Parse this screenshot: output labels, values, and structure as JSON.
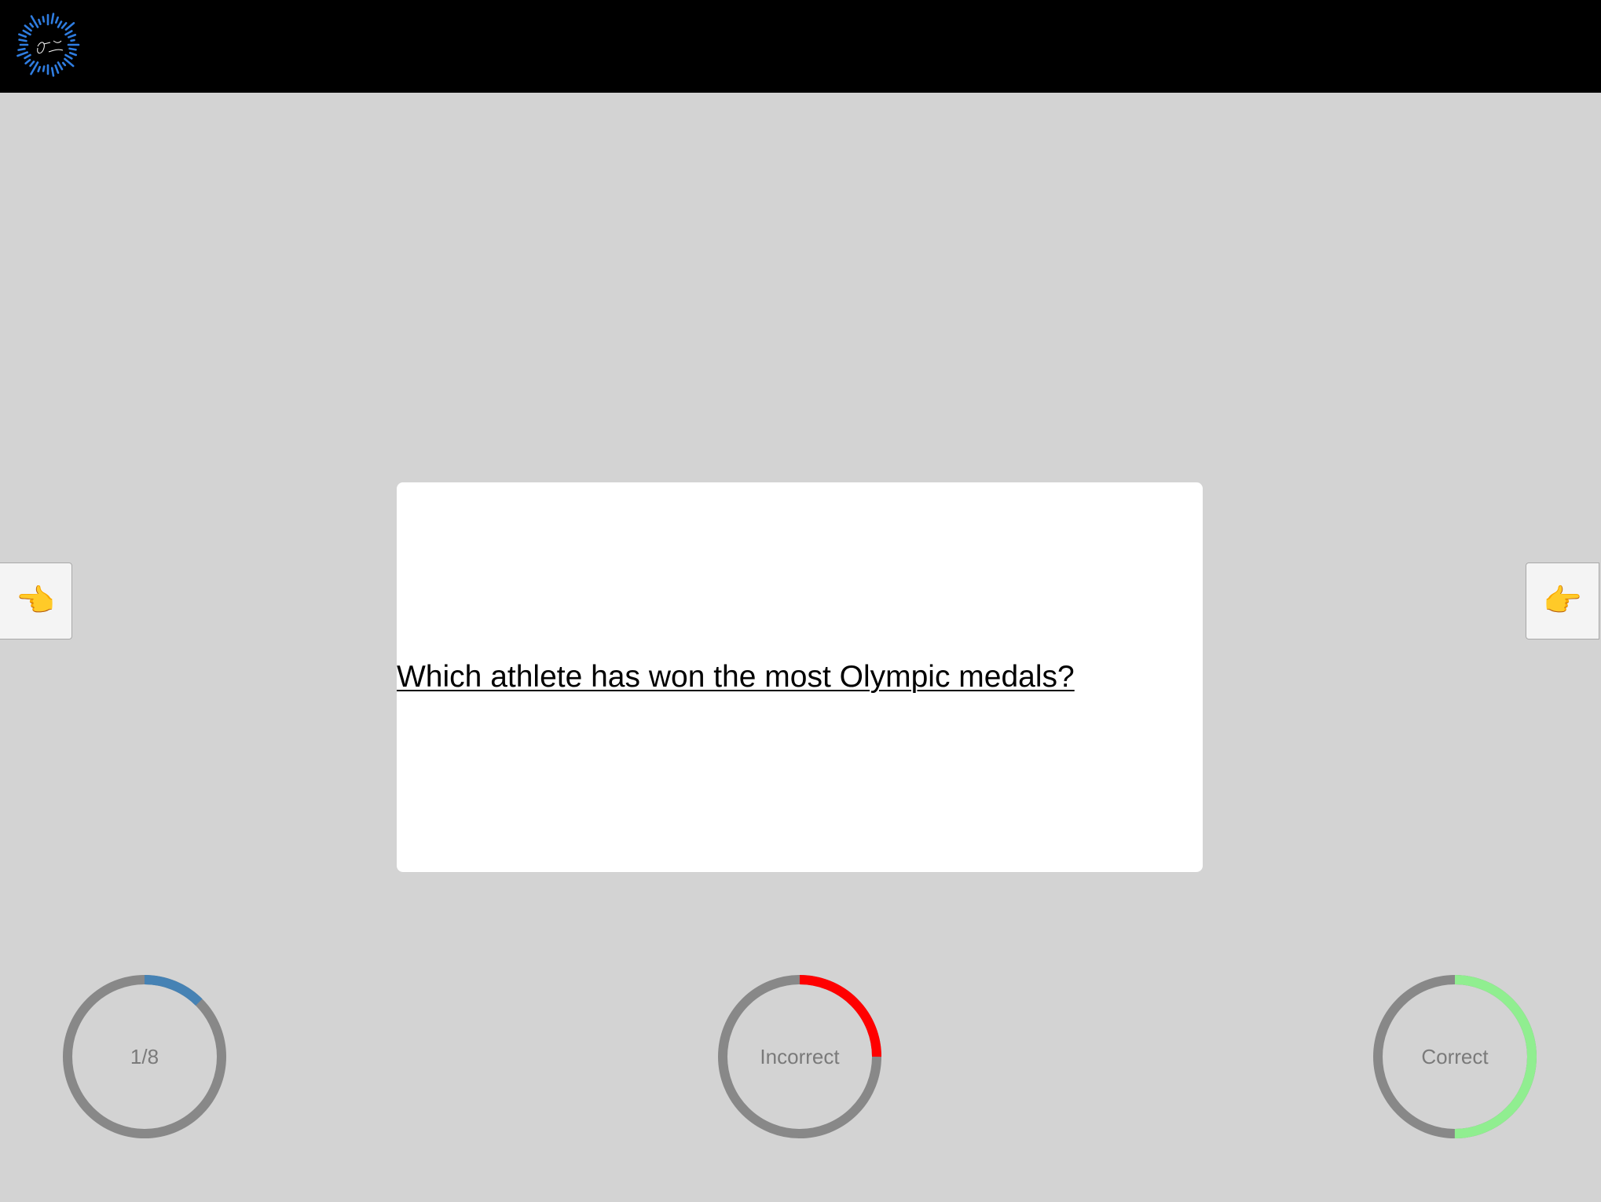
{
  "header": {
    "logo_icon": "starburst-signature-logo"
  },
  "nav": {
    "prev_icon": "hand-pointing-left-icon",
    "prev_glyph": "👈",
    "next_icon": "hand-pointing-right-icon",
    "next_glyph": "👉"
  },
  "card": {
    "question": "Which athlete has won the most Olympic medals?"
  },
  "stats": {
    "progress": {
      "label": "1/8",
      "current": 1,
      "total": 8,
      "fraction": 0.125,
      "color": "#4682b4"
    },
    "incorrect": {
      "label": "Incorrect",
      "fraction": 0.25,
      "color": "#ff0000"
    },
    "correct": {
      "label": "Correct",
      "fraction": 0.5,
      "color": "#90ee90"
    },
    "track_color": "#888888"
  }
}
